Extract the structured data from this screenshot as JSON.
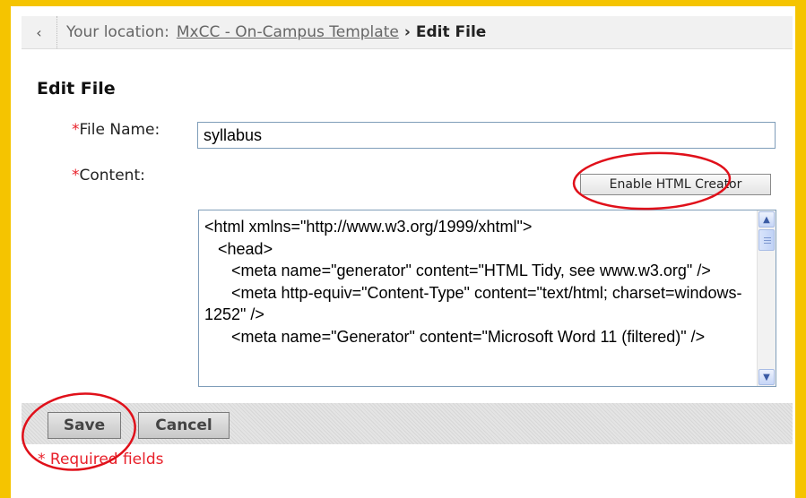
{
  "breadcrumb": {
    "back_icon": "chevron-left-icon",
    "prefix": "Your location:",
    "link": "MxCC - On-Campus Template",
    "separator": "›",
    "current": "Edit File"
  },
  "page_title": "Edit File",
  "form": {
    "required_marker": "*",
    "file_name_label": "File Name:",
    "file_name_value": "syllabus",
    "content_label": "Content:",
    "enable_html_creator_label": "Enable HTML Creator",
    "content_value": "<html xmlns=\"http://www.w3.org/1999/xhtml\">\n   <head>\n      <meta name=\"generator\" content=\"HTML Tidy, see www.w3.org\" />\n      <meta http-equiv=\"Content-Type\" content=\"text/html; charset=windows-1252\" />\n      <meta name=\"Generator\" content=\"Microsoft Word 11 (filtered)\" />"
  },
  "actions": {
    "save_label": "Save",
    "cancel_label": "Cancel"
  },
  "required_note": "* Required fields",
  "colors": {
    "frame": "#f5c400",
    "required": "#e8202a",
    "annotation_circle": "#e0101a"
  }
}
